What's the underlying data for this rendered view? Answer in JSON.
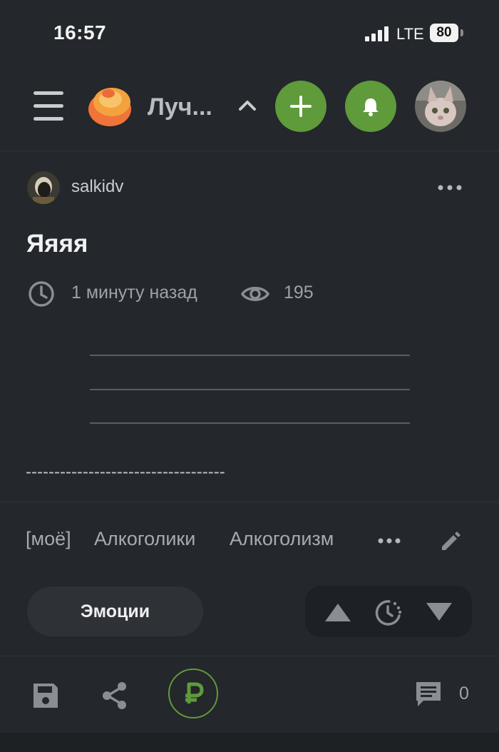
{
  "status_bar": {
    "time": "16:57",
    "network": "LTE",
    "battery": "80"
  },
  "header": {
    "title": "Луч...",
    "accent_color": "#5f9a3b"
  },
  "post": {
    "author": "salkidv",
    "title": "Яяяя",
    "time_ago": "1 минуту назад",
    "views": "195",
    "separator_text": "-----------------------------------"
  },
  "tags": [
    "[моё]",
    "Алкоголики",
    "Алкоголизм"
  ],
  "actions": {
    "emotions_label": "Эмоции"
  },
  "footer": {
    "comments_count": "0"
  },
  "icons": [
    "menu-icon",
    "logo-icon",
    "chevron-up-icon",
    "plus-icon",
    "bell-icon",
    "clock-icon",
    "eye-icon",
    "more-icon",
    "pencil-icon",
    "arrow-up-icon",
    "hot-icon",
    "arrow-down-icon",
    "save-icon",
    "share-icon",
    "ruble-icon",
    "comment-icon"
  ]
}
